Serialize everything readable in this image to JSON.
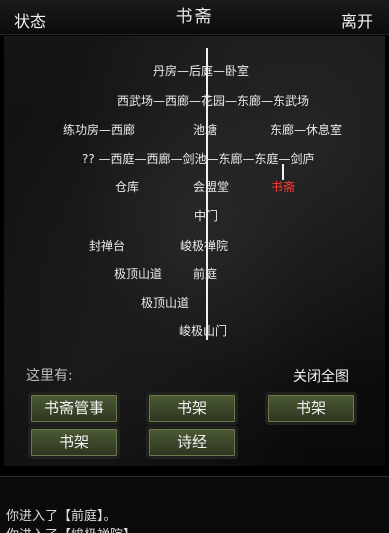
{
  "header": {
    "left_button": "状态",
    "title": "书斋",
    "right_button": "离开"
  },
  "map": {
    "rooms": {
      "r1": "丹房—后庭—卧室",
      "r2": "西武场—西廊—花园—东廊—东武场",
      "r3a": "练功房—西廊",
      "r3b": "池塘",
      "r3c": "东廊—休息室",
      "r4": "?? —西庭—西廊—剑池—东廊—东庭—剑庐",
      "r5a": "仓库",
      "r5b": "会盟堂",
      "r5c": "书斋",
      "r6": "中门",
      "r7a": "封禅台",
      "r7b": "峻极禅院",
      "r8a": "极顶山道",
      "r8b": "前庭",
      "r9": "极顶山道",
      "r10": "峻极山门"
    },
    "current_room": "书斋"
  },
  "here_label": "这里有:",
  "close_map_label": "关闭全图",
  "npcs": {
    "b1": "书斋管事",
    "b2": "书架",
    "b3": "书架",
    "b4": "书架",
    "b5": "诗经"
  },
  "log": {
    "line1": "你进入了【前庭】。",
    "line2": "你进入了【峻极禅院】。"
  }
}
